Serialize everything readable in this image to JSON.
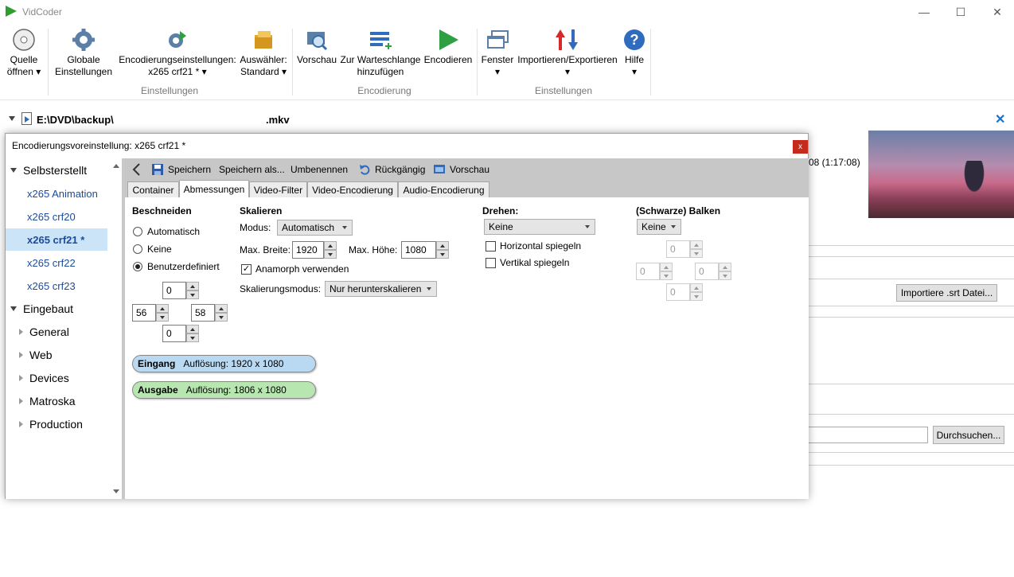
{
  "app": {
    "title": "VidCoder",
    "minimize": "—",
    "maximize": "☐",
    "close": "✕"
  },
  "ribbon": {
    "source_open": {
      "line1": "Quelle",
      "line2": "öffnen ▾"
    },
    "global_settings": {
      "line1": "Globale",
      "line2": "Einstellungen"
    },
    "encoding_settings": {
      "line1": "Encodierungseinstellungen:",
      "line2": "x265 crf21 * ▾"
    },
    "picker": {
      "line1": "Auswähler:",
      "line2": "Standard ▾"
    },
    "preview": {
      "line1": "Vorschau",
      "line2": ""
    },
    "add_queue": {
      "line1": "Zur Warteschlange",
      "line2": "hinzufügen"
    },
    "encode": {
      "line1": "Encodieren",
      "line2": ""
    },
    "window": {
      "line1": "Fenster",
      "line2": "▾"
    },
    "import_export": {
      "line1": "Importieren/Exportieren",
      "line2": "▾"
    },
    "help": {
      "line1": "Hilfe",
      "line2": "▾"
    },
    "groups": {
      "settings": "Einstellungen",
      "encoding": "Encodierung",
      "settings2": "Einstellungen"
    }
  },
  "source": {
    "path": "E:\\DVD\\backup\\",
    "ext": ".mkv",
    "close": "✕",
    "duration": "08   (1:17:08)"
  },
  "background": {
    "srt_button": "Importiere .srt Datei...",
    "browse_button": "Durchsuchen..."
  },
  "dialog": {
    "title": "Encodierungsvoreinstellung: x265 crf21 *",
    "close": "x",
    "tree": {
      "custom": "Selbsterstellt",
      "custom_items": [
        "x265 Animation",
        "x265 crf20",
        "x265 crf21 *",
        "x265 crf22",
        "x265 crf23"
      ],
      "builtin": "Eingebaut",
      "builtin_items": [
        "General",
        "Web",
        "Devices",
        "Matroska",
        "Production"
      ]
    },
    "toolbar": {
      "save": "Speichern",
      "save_as": "Speichern als...",
      "rename": "Umbenennen",
      "undo": "Rückgängig",
      "preview": "Vorschau"
    },
    "tabs": [
      "Container",
      "Abmessungen",
      "Video-Filter",
      "Video-Encodierung",
      "Audio-Encodierung"
    ],
    "crop": {
      "title": "Beschneiden",
      "auto": "Automatisch",
      "none": "Keine",
      "custom": "Benutzerdefiniert",
      "top": "0",
      "left": "56",
      "right": "58",
      "bottom": "0"
    },
    "scale": {
      "title": "Skalieren",
      "mode_label": "Modus:",
      "mode_value": "Automatisch",
      "max_width_label": "Max. Breite:",
      "max_width": "1920",
      "max_height_label": "Max. Höhe:",
      "max_height": "1080",
      "anamorphic": "Anamorph verwenden",
      "scaling_mode_label": "Skalierungsmodus:",
      "scaling_mode_value": "Nur herunterskalieren"
    },
    "rotate": {
      "title": "Drehen:",
      "value": "Keine",
      "flip_h": "Horizontal spiegeln",
      "flip_v": "Vertikal spiegeln"
    },
    "bars": {
      "title": "(Schwarze) Balken",
      "value": "Keine",
      "top": "0",
      "left": "0",
      "right": "0",
      "bottom": "0"
    },
    "input": {
      "label": "Eingang",
      "text": "Auflösung: 1920 x 1080"
    },
    "output": {
      "label": "Ausgabe",
      "text": "Auflösung: 1806 x 1080"
    }
  },
  "colors": {
    "accent": "#1f6fc5",
    "selected_bg": "#cce4f7",
    "input_pill": "#b9d9f2",
    "output_pill": "#b8e6b0"
  }
}
